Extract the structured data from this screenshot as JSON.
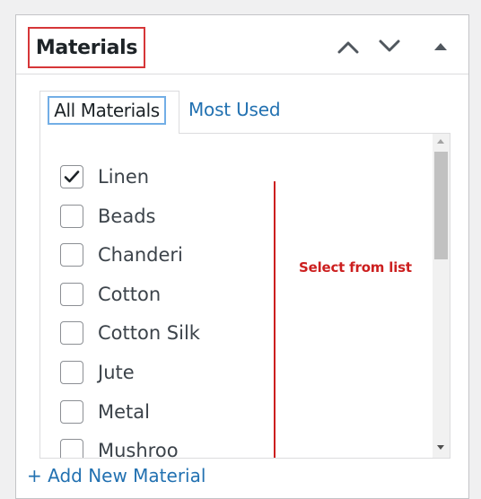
{
  "metabox": {
    "title": "Materials",
    "controls": {
      "move_up_icon": "chevron-up-icon",
      "move_down_icon": "chevron-down-icon",
      "toggle_icon": "triangle-up-icon"
    }
  },
  "tabs": [
    {
      "label": "All Materials",
      "active": true
    },
    {
      "label": "Most Used",
      "active": false
    }
  ],
  "materials": [
    {
      "label": "Linen",
      "checked": true
    },
    {
      "label": "Beads",
      "checked": false
    },
    {
      "label": "Chanderi",
      "checked": false
    },
    {
      "label": "Cotton",
      "checked": false
    },
    {
      "label": "Cotton Silk",
      "checked": false
    },
    {
      "label": "Jute",
      "checked": false
    },
    {
      "label": "Metal",
      "checked": false
    },
    {
      "label": "Mushroo",
      "checked": false
    }
  ],
  "annotation": {
    "text": "Select from list",
    "color": "#cc1f1f"
  },
  "add_new_link": "+ Add New Material",
  "colors": {
    "link": "#2271b1",
    "highlight_border": "#d63638",
    "focus_border": "#72aee6"
  }
}
